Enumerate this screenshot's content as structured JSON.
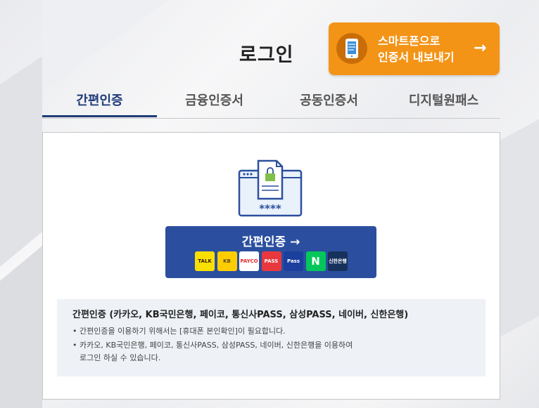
{
  "page": {
    "title": "로그인"
  },
  "export": {
    "line1": "스마트폰으로",
    "line2": "인증서 내보내기",
    "arrow": "→"
  },
  "tabs": [
    {
      "label": "간편인증"
    },
    {
      "label": "금융인증서"
    },
    {
      "label": "공동인증서"
    },
    {
      "label": "디지털원패스"
    }
  ],
  "panel": {
    "illustration_text": "****",
    "cert_button_label": "간편인증 →",
    "providers": [
      {
        "name": "TALK",
        "bg": "#f9e000",
        "fg": "#3a1d1d"
      },
      {
        "name": "KB",
        "bg": "#ffcc00",
        "fg": "#5a4a2a"
      },
      {
        "name": "PAYCO",
        "bg": "#ffffff",
        "fg": "#e8262a"
      },
      {
        "name": "PASS",
        "bg": "#e8383d",
        "fg": "#ffffff"
      },
      {
        "name": "Pass",
        "bg": "#1a3f9e",
        "fg": "#ffffff"
      },
      {
        "name": "N",
        "bg": "#03c75a",
        "fg": "#ffffff"
      },
      {
        "name": "신한은행",
        "bg": "#16325c",
        "fg": "#ffffff"
      }
    ],
    "info": {
      "title": "간편인증 (카카오, KB국민은행, 페이코, 통신사PASS, 삼성PASS, 네이버, 신한은행)",
      "items": [
        "간편인증을 이용하기 위해서는 [휴대폰 본인확인]이 필요합니다.",
        "카카오, KB국민은행, 페이코, 통신사PASS, 삼성PASS, 네이버, 신한은행을 이용하여",
        "로그인 하실 수 있습니다."
      ],
      "bullet": "•"
    }
  },
  "colors": {
    "accent": "#1f3b78",
    "export_btn": "#f39417",
    "cert_btn": "#2b4f9e"
  }
}
